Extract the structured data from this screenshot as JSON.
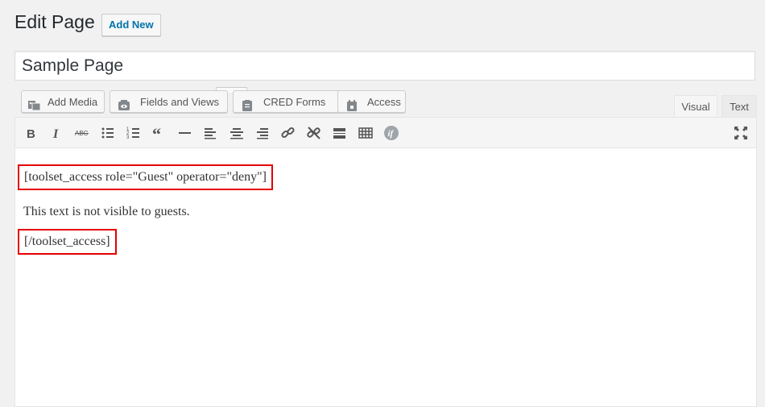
{
  "header": {
    "title": "Edit Page",
    "add_new_label": "Add New"
  },
  "post_title": "Sample Page",
  "media_buttons": [
    {
      "label": "Add Media",
      "icon": "add-media-icon"
    },
    {
      "label": "Fields and Views",
      "icon": "views-icon"
    },
    {
      "label": "CRED Forms",
      "icon": "cred-forms-icon"
    },
    {
      "label": "Access",
      "icon": "lock-icon"
    }
  ],
  "tabs": {
    "visual": "Visual",
    "text": "Text"
  },
  "toolbar_icons": [
    "bold-icon",
    "italic-icon",
    "strikethrough-icon",
    "bulleted-list-icon",
    "numbered-list-icon",
    "blockquote-icon",
    "horizontal-line-icon",
    "align-left-icon",
    "align-center-icon",
    "align-right-icon",
    "insert-link-icon",
    "remove-link-icon",
    "read-more-icon",
    "toolbar-toggle-icon",
    "conditional-output-icon",
    "fullscreen-icon"
  ],
  "content": {
    "line1": "[toolset_access role=\"Guest\" operator=\"deny\"]",
    "line2": "This text is not visible to guests.",
    "line3": "[/toolset_access]"
  },
  "colors": {
    "highlight_border": "#e60000",
    "link_blue": "#0073aa"
  }
}
